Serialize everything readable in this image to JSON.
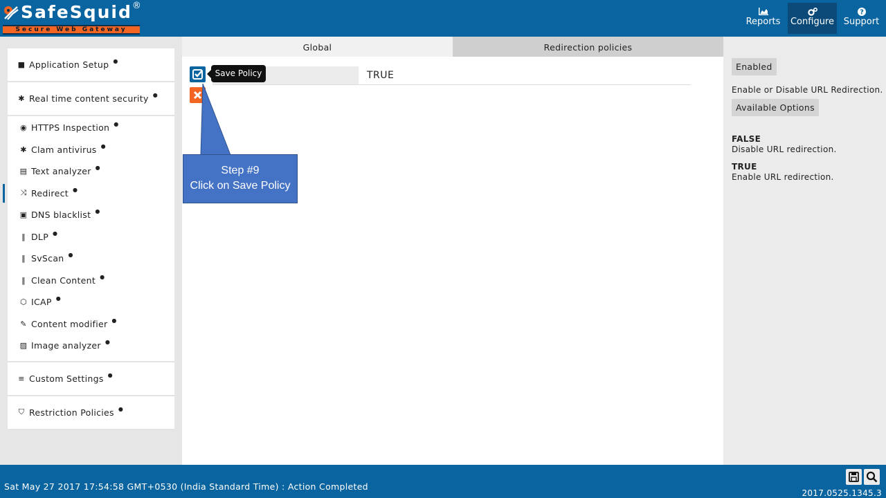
{
  "app": {
    "name": "SafeSquid",
    "reg_mark": "®",
    "tagline": "Secure Web Gateway"
  },
  "nav": {
    "reports": "Reports",
    "configure": "Configure",
    "support": "Support"
  },
  "sidebar": {
    "application_setup": "Application Setup",
    "realtime_content_security": "Real time content security",
    "items": [
      {
        "label": "HTTPS Inspection",
        "icon": "eye-icon"
      },
      {
        "label": "Clam antivirus",
        "icon": "bug-icon"
      },
      {
        "label": "Text analyzer",
        "icon": "file-text-icon"
      },
      {
        "label": "Redirect",
        "icon": "shuffle-icon"
      },
      {
        "label": "DNS blacklist",
        "icon": "dns-icon"
      },
      {
        "label": "DLP",
        "icon": "barcode-icon"
      },
      {
        "label": "SvScan",
        "icon": "barcode-icon"
      },
      {
        "label": "Clean Content",
        "icon": "barcode-icon"
      },
      {
        "label": "ICAP",
        "icon": "hexagon-icon"
      },
      {
        "label": "Content modifier",
        "icon": "edit-icon"
      },
      {
        "label": "Image analyzer",
        "icon": "image-icon"
      }
    ],
    "custom_settings": "Custom Settings",
    "restriction_policies": "Restriction Policies",
    "active_item": "Redirect"
  },
  "tabs": {
    "global": "Global",
    "redirection_policies": "Redirection policies"
  },
  "form": {
    "value": "TRUE",
    "save_tooltip": "Save Policy"
  },
  "callout": {
    "line1": "Step #9",
    "line2": "Click on Save Policy"
  },
  "help": {
    "field_name": "Enabled",
    "description": "Enable or Disable URL Redirection.",
    "options_label": "Available Options",
    "options": [
      {
        "key": "FALSE",
        "desc": "Disable URL redirection."
      },
      {
        "key": "TRUE",
        "desc": "Enable URL redirection."
      }
    ]
  },
  "footer": {
    "status": "Sat May 27 2017 17:54:58 GMT+0530 (India Standard Time) : Action Completed",
    "version": "2017.0525.1345.3"
  },
  "colors": {
    "primary": "#0a64a0",
    "accent": "#f26522",
    "callout": "#4472c4"
  }
}
